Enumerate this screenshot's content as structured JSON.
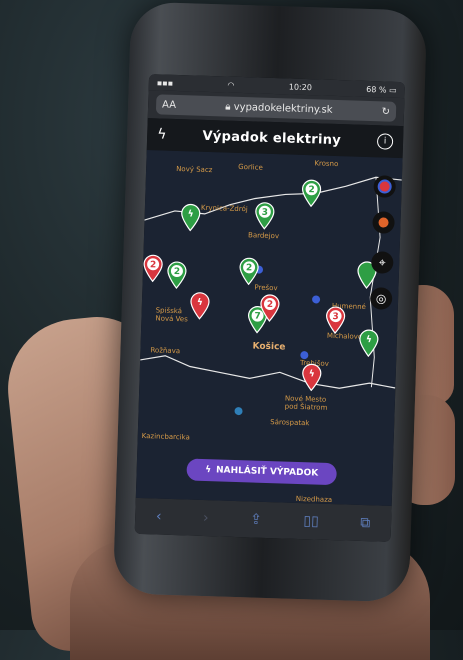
{
  "status": {
    "time": "10:20",
    "battery": "68 %"
  },
  "browser": {
    "text_size": "AA",
    "url": "vypadokelektriny.sk"
  },
  "app": {
    "title": "Výpadok elektriny",
    "report_button": "NAHLÁSIŤ VÝPADOK"
  },
  "map": {
    "labels": [
      {
        "name": "Nový Sacz"
      },
      {
        "name": "Gorlice"
      },
      {
        "name": "Krosno"
      },
      {
        "name": "Krynica-Zdrój"
      },
      {
        "name": "Bardejov"
      },
      {
        "name": "Spišská Nová Ves"
      },
      {
        "name": "Prešov"
      },
      {
        "name": "Humenné"
      },
      {
        "name": "Rožňava"
      },
      {
        "name": "Košice"
      },
      {
        "name": "Michalovce"
      },
      {
        "name": "Trebišov"
      },
      {
        "name": "Nové Mesto pod Šiatrom"
      },
      {
        "name": "Sárospatak"
      },
      {
        "name": "Kazincbarcika"
      },
      {
        "name": "Nizedhaza"
      }
    ],
    "pins": [
      {
        "label": "2",
        "color": "#2e9e44"
      },
      {
        "label": "3",
        "color": "#2e9e44"
      },
      {
        "label": "",
        "color": "#2e9e44"
      },
      {
        "label": "2",
        "color": "#d9363e"
      },
      {
        "label": "2",
        "color": "#2e9e44"
      },
      {
        "label": "2",
        "color": "#2e9e44"
      },
      {
        "label": "",
        "color": "#d9363e"
      },
      {
        "label": "7",
        "color": "#2e9e44"
      },
      {
        "label": "2",
        "color": "#d9363e"
      },
      {
        "label": "3",
        "color": "#d9363e"
      },
      {
        "label": "",
        "color": "#2e9e44"
      },
      {
        "label": "",
        "color": "#d9363e"
      },
      {
        "label": "",
        "color": "#2e9e44"
      }
    ],
    "controls": [
      {
        "icon": "layer-dot-icon",
        "color": "#d9363e"
      },
      {
        "icon": "layer-dot-icon",
        "color": "#e0642a"
      },
      {
        "icon": "locate-icon"
      },
      {
        "icon": "globe-icon"
      }
    ]
  },
  "colors": {
    "accent": "#6b46c1",
    "outage_red": "#d9363e",
    "restored_green": "#2e9e44"
  }
}
